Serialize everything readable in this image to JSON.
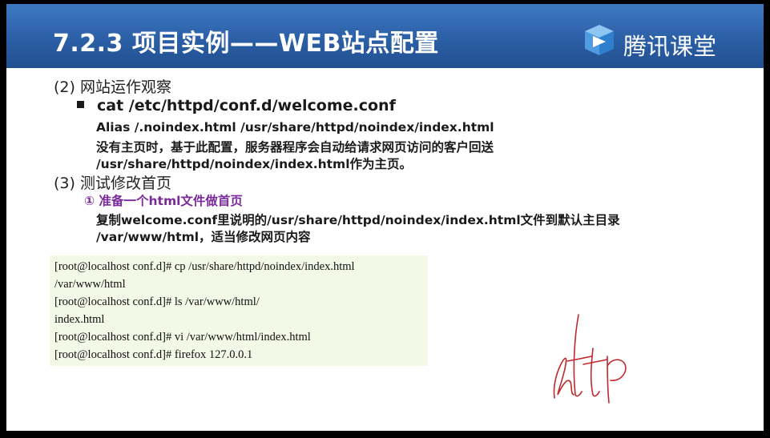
{
  "header": {
    "title": "7.2.3  项目实例——WEB站点配置",
    "logo_text": "腾讯课堂",
    "logo_icon": "tencent-classroom-logo"
  },
  "content": {
    "section2_heading": "(2) 网站运作观察",
    "bullet_command": "cat /etc/httpd/conf.d/welcome.conf",
    "alias_line": "Alias  /.noindex.html  /usr/share/httpd/noindex/index.html",
    "explain_line1": "没有主页时，基于此配置，服务器程序会自动给请求网页访问的客户回送",
    "explain_line2": "/usr/share/httpd/noindex/index.html作为主页。",
    "section3_heading": "(3) 测试修改首页",
    "step1_label": "① 准备一个html文件做首页",
    "step1_line1": "复制welcome.conf里说明的/usr/share/httpd/noindex/index.html文件到默认主目录",
    "step1_line2": "/var/www/html，适当修改网页内容"
  },
  "terminal": {
    "lines": [
      "[root@localhost  conf.d]# cp /usr/share/httpd/noindex/index.html",
      "/var/www/html",
      "[root@localhost  conf.d]# ls /var/www/html/",
      "index.html",
      "[root@localhost  conf.d]# vi /var/www/html/index.html",
      "[root@localhost  conf.d]# firefox  127.0.0.1"
    ]
  },
  "annotation": {
    "handwriting_text": "http",
    "color": "#c0282c"
  }
}
